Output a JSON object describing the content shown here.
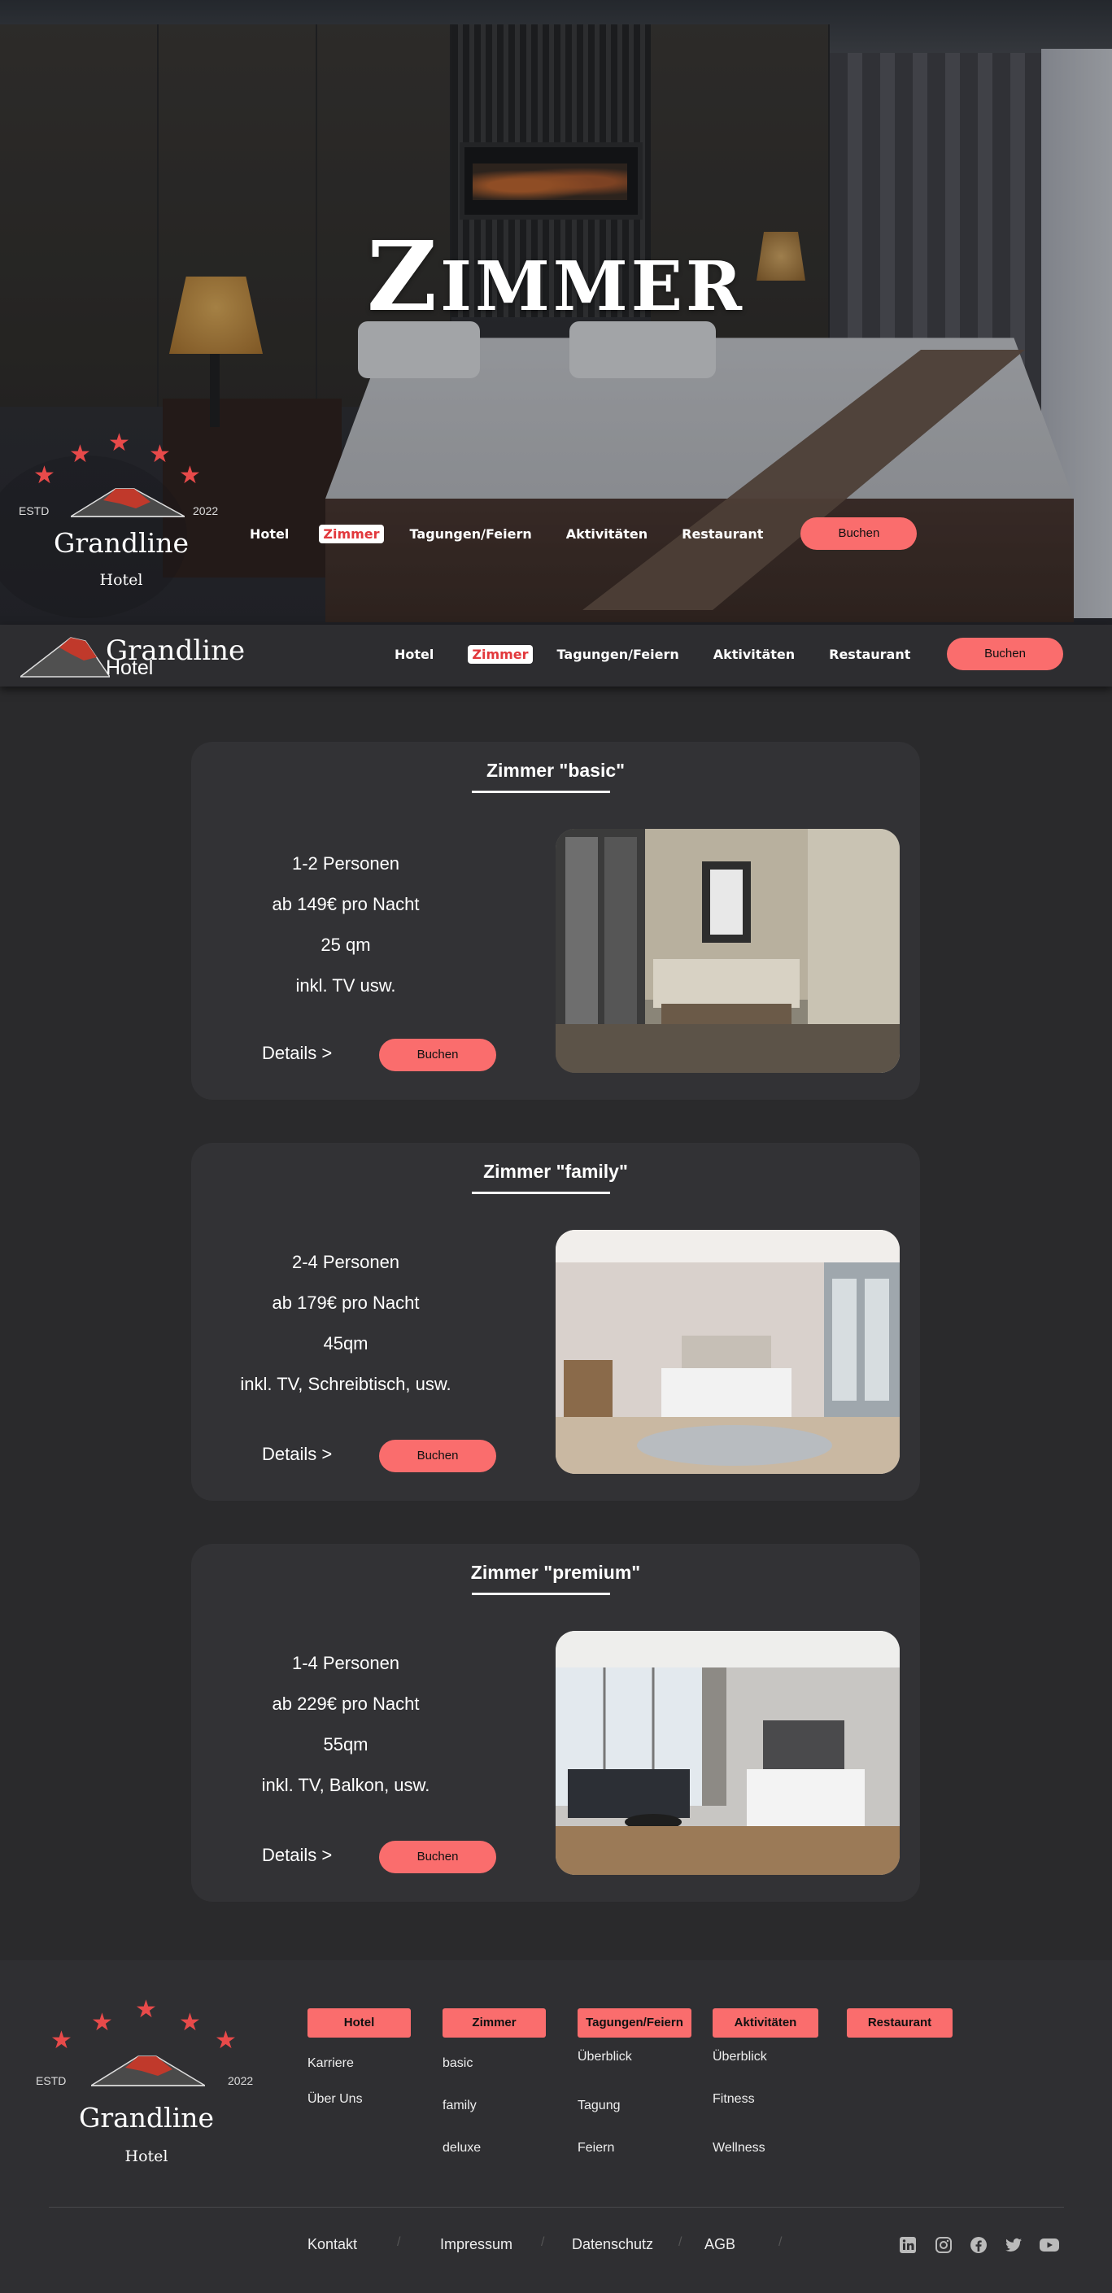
{
  "hero": {
    "title": "Zimmer",
    "logo": {
      "estd": "ESTD",
      "year": "2022",
      "name": "Grandline",
      "sub": "Hotel"
    }
  },
  "nav": {
    "items": [
      "Hotel",
      "Zimmer",
      "Tagungen/Feiern",
      "Aktivitäten",
      "Restaurant"
    ],
    "active": "Zimmer",
    "book_label": "Buchen"
  },
  "bar": {
    "logo_name": "Grandline",
    "logo_sub": "Hotel"
  },
  "rooms": [
    {
      "title": "Zimmer \"basic\"",
      "lines": [
        "1-2 Personen",
        "ab 149€ pro Nacht",
        "25 qm",
        "inkl. TV usw."
      ],
      "details": "Details >",
      "book": "Buchen"
    },
    {
      "title": "Zimmer \"family\"",
      "lines": [
        "2-4 Personen",
        "ab 179€ pro Nacht",
        "45qm",
        "inkl. TV, Schreibtisch, usw."
      ],
      "details": "Details >",
      "book": "Buchen"
    },
    {
      "title": "Zimmer \"premium\"",
      "lines": [
        "1-4 Personen",
        "ab 229€ pro Nacht",
        "55qm",
        "inkl. TV, Balkon, usw."
      ],
      "details": "Details >",
      "book": "Buchen"
    }
  ],
  "footer": {
    "logo": {
      "estd": "ESTD",
      "year": "2022",
      "name": "Grandline",
      "sub": "Hotel"
    },
    "columns": [
      {
        "title": "Hotel",
        "links": [
          "Karriere",
          "Über Uns"
        ]
      },
      {
        "title": "Zimmer",
        "links": [
          "basic",
          "family",
          "deluxe"
        ]
      },
      {
        "title": "Tagungen/Feiern",
        "links": [
          "Überblick",
          "Tagung",
          "Feiern"
        ]
      },
      {
        "title": "Aktivitäten",
        "links": [
          "Überblick",
          "Fitness",
          "Wellness"
        ]
      },
      {
        "title": "Restaurant",
        "links": []
      }
    ],
    "bottom_links": [
      "Kontakt",
      "Impressum",
      "Datenschutz",
      "AGB"
    ],
    "separator": "/",
    "social": [
      "linkedin-icon",
      "instagram-icon",
      "facebook-icon",
      "twitter-icon",
      "youtube-icon"
    ]
  },
  "colors": {
    "accent": "#fa6d6d",
    "active_nav_text": "#e2383c",
    "page_bg": "#2a2a2c",
    "card_bg": "#323235",
    "star": "#e84a4a"
  }
}
